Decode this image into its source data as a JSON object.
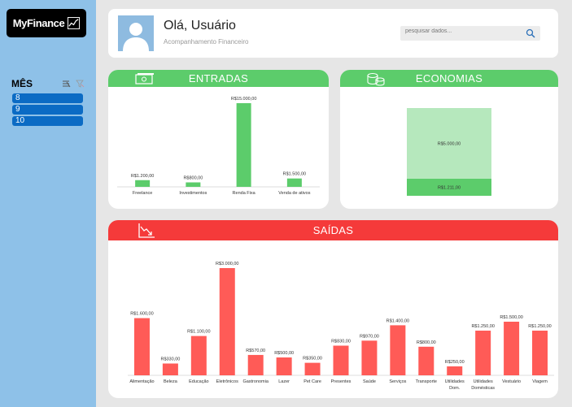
{
  "app": {
    "logo_text": "MyFinance"
  },
  "slicer": {
    "title": "MÊS",
    "items": [
      "8",
      "9",
      "10"
    ]
  },
  "header": {
    "greeting": "Olá, Usuário",
    "subtitle": "Acompanhamento Financeiro",
    "search_placeholder": "pesquisar dados..."
  },
  "colors": {
    "income_green": "#5ccc6b",
    "savings_light_green": "#b6e8bd",
    "expense_red": "#f53a3a",
    "expense_bar": "#ff5b57",
    "sidebar_blue": "#8ec1e8",
    "slicer_blue": "#0b6bc4"
  },
  "cards": {
    "entradas": {
      "title": "ENTRADAS",
      "icon": "cash-icon"
    },
    "economias": {
      "title": "ECONOMIAS",
      "icon": "coins-icon"
    },
    "saidas": {
      "title": "SAÍDAS",
      "icon": "chart-down-icon"
    }
  },
  "chart_data": [
    {
      "id": "entradas",
      "type": "bar",
      "categories": [
        "Freelance",
        "Investimentos",
        "Renda Fixa",
        "Venda de ativos"
      ],
      "values": [
        1200,
        800,
        15000,
        1500
      ],
      "data_labels": [
        "R$1.200,00",
        "R$800,00",
        "R$15.000,00",
        "R$1.500,00"
      ],
      "ylim": [
        0,
        15000
      ]
    },
    {
      "id": "economias",
      "type": "bar",
      "stacked": true,
      "segments": [
        {
          "value": 1211,
          "label": "R$1.211,00",
          "color": "#5ccc6b"
        },
        {
          "value": 5000,
          "label": "R$5.000,00",
          "color": "#b6e8bd"
        }
      ]
    },
    {
      "id": "saidas",
      "type": "bar",
      "categories": [
        [
          "Alimentação"
        ],
        [
          "Beleza"
        ],
        [
          "Educação"
        ],
        [
          "Eletrônicos"
        ],
        [
          "Gastronomia"
        ],
        [
          "Lazer"
        ],
        [
          "Pet Care"
        ],
        [
          "Presentes"
        ],
        [
          "Saúde"
        ],
        [
          "Serviços"
        ],
        [
          "Transporte"
        ],
        [
          "Utilidades",
          "Dom."
        ],
        [
          "Utilidades",
          "Domésticas"
        ],
        [
          "Vestuário"
        ],
        [
          "Viagem"
        ]
      ],
      "values": [
        1600,
        330,
        1100,
        3000,
        570,
        500,
        350,
        830,
        970,
        1400,
        800,
        250,
        1250,
        1500,
        1250
      ],
      "data_labels": [
        "R$1.600,00",
        "R$330,00",
        "R$1.100,00",
        "R$3.000,00",
        "R$570,00",
        "R$500,00",
        "R$350,00",
        "R$830,00",
        "R$970,00",
        "R$1.400,00",
        "R$800,00",
        "R$250,00",
        "R$1.250,00",
        "R$1.500,00",
        "R$1.250,00"
      ],
      "ylim": [
        0,
        3000
      ]
    }
  ]
}
